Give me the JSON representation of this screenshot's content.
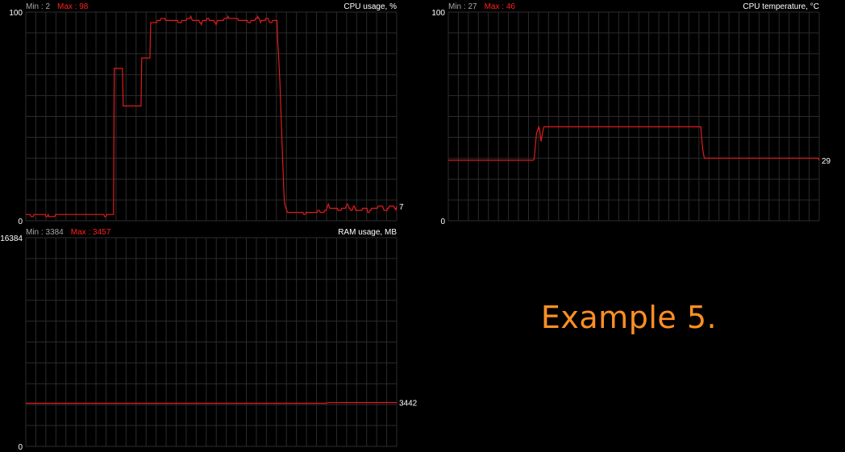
{
  "colors": {
    "background": "#000000",
    "grid": "#2b2b2b",
    "series": "#e31b1b",
    "min_label": "#a7a7a7",
    "max_label": "#ff2020",
    "title": "#ffffff",
    "axis_label": "#ffffff",
    "caption": "#ff8f23"
  },
  "caption": "Example 5.",
  "chart_data": [
    {
      "type": "line",
      "title": "CPU usage, %",
      "min_text": "Min : 2",
      "max_text": "Max : 98",
      "ylim": [
        0,
        100
      ],
      "ytick_top": "100",
      "ytick_bottom": "0",
      "current": "7",
      "values": [
        3,
        3,
        3,
        3,
        3,
        3,
        3,
        2,
        2,
        2,
        2,
        3,
        3,
        3,
        3,
        3,
        3,
        3,
        3,
        3,
        3,
        3,
        3,
        3,
        3,
        3,
        3,
        2,
        2,
        2,
        3,
        2,
        2,
        2,
        2,
        2,
        2,
        2,
        2,
        2,
        3,
        3,
        3,
        3,
        3,
        3,
        3,
        3,
        3,
        3,
        3,
        3,
        3,
        3,
        3,
        3,
        3,
        3,
        3,
        3,
        3,
        3,
        3,
        3,
        3,
        3,
        3,
        3,
        3,
        3,
        3,
        3,
        3,
        3,
        3,
        3,
        3,
        3,
        3,
        3,
        3,
        3,
        3,
        3,
        3,
        3,
        3,
        3,
        3,
        3,
        3,
        3,
        3,
        3,
        3,
        3,
        3,
        3,
        3,
        3,
        3,
        3,
        3,
        3,
        3,
        3,
        2,
        2,
        2,
        3,
        3,
        3,
        3,
        3,
        3,
        3,
        3,
        3,
        3,
        73,
        73,
        73,
        73,
        73,
        73,
        73,
        73,
        73,
        73,
        73,
        73,
        55,
        55,
        55,
        55,
        55,
        55,
        55,
        55,
        55,
        55,
        55,
        55,
        55,
        55,
        55,
        55,
        55,
        55,
        55,
        55,
        55,
        55,
        55,
        55,
        55,
        78,
        78,
        78,
        78,
        78,
        78,
        78,
        78,
        78,
        78,
        78,
        78,
        95,
        95,
        95,
        95,
        95,
        95,
        95,
        95,
        95,
        96,
        96,
        96,
        96,
        96,
        97,
        97,
        97,
        97,
        97,
        97,
        96,
        96,
        96,
        96,
        96,
        96,
        96,
        96,
        96,
        96,
        96,
        96,
        96,
        96,
        96,
        96,
        96,
        95,
        95,
        95,
        95,
        95,
        96,
        96,
        96,
        96,
        96,
        96,
        96,
        97,
        97,
        97,
        97,
        97,
        98,
        97,
        96,
        96,
        96,
        96,
        96,
        96,
        96,
        96,
        96,
        96,
        95,
        95,
        94,
        95,
        96,
        96,
        96,
        96,
        96,
        96,
        97,
        97,
        97,
        96,
        96,
        96,
        96,
        96,
        96,
        96,
        95,
        95,
        94,
        95,
        96,
        96,
        96,
        96,
        96,
        96,
        96,
        96,
        96,
        97,
        97,
        97,
        97,
        97,
        98,
        97,
        97,
        97,
        97,
        97,
        97,
        97,
        97,
        97,
        97,
        97,
        97,
        97,
        96,
        96,
        96,
        96,
        96,
        96,
        96,
        96,
        96,
        96,
        96,
        96,
        96,
        95,
        95,
        95,
        95,
        96,
        96,
        96,
        96,
        96,
        96,
        97,
        97,
        97,
        98,
        97,
        97,
        96,
        95,
        96,
        96,
        96,
        96,
        96,
        96,
        97,
        97,
        97,
        97,
        96,
        95,
        95,
        95,
        95,
        96,
        96,
        96,
        96,
        96,
        96,
        96,
        85,
        80,
        73,
        65,
        55,
        45,
        35,
        25,
        15,
        9,
        7,
        6,
        5,
        4,
        4,
        4,
        4,
        4,
        4,
        4,
        4,
        4,
        4,
        4,
        4,
        4,
        4,
        4,
        4,
        4,
        4,
        4,
        4,
        4,
        4,
        3,
        3,
        3,
        4,
        4,
        4,
        4,
        4,
        4,
        4,
        4,
        4,
        4,
        4,
        4,
        4,
        4,
        4,
        4,
        5,
        5,
        5,
        4,
        4,
        4,
        4,
        4,
        4,
        5,
        5,
        5,
        6,
        7,
        8,
        7,
        6,
        6,
        6,
        6,
        6,
        6,
        6,
        6,
        6,
        6,
        6,
        5,
        5,
        5,
        5,
        5,
        6,
        6,
        6,
        6,
        6,
        6,
        7,
        8,
        8,
        7,
        6,
        6,
        5,
        5,
        5,
        6,
        7,
        7,
        6,
        5,
        5,
        5,
        5,
        5,
        5,
        5,
        5,
        5,
        6,
        6,
        6,
        6,
        6,
        6,
        6,
        4,
        4,
        4,
        5,
        5,
        6,
        6,
        6,
        6,
        6,
        6,
        6,
        6,
        6,
        7,
        7,
        7,
        7,
        7,
        7,
        7,
        6,
        5,
        5,
        5,
        5,
        5,
        6,
        6,
        7,
        7,
        7,
        7,
        7,
        7,
        7,
        6,
        6,
        5,
        7
      ]
    },
    {
      "type": "line",
      "title": "CPU temperature, °C",
      "min_text": "Min : 27",
      "max_text": "Max : 46",
      "ylim": [
        0,
        100
      ],
      "ytick_top": "100",
      "ytick_bottom": "0",
      "current": "29",
      "values": [
        29,
        29,
        29,
        29,
        29,
        29,
        29,
        29,
        29,
        29,
        29,
        29,
        29,
        29,
        29,
        29,
        29,
        29,
        29,
        29,
        29,
        29,
        29,
        29,
        29,
        29,
        29,
        29,
        29,
        29,
        29,
        29,
        29,
        29,
        29,
        29,
        29,
        29,
        29,
        29,
        29,
        29,
        29,
        29,
        29,
        29,
        29,
        29,
        29,
        29,
        29,
        29,
        29,
        29,
        29,
        29,
        29,
        29,
        29,
        29,
        29,
        29,
        29,
        29,
        29,
        29,
        29,
        29,
        29,
        29,
        29,
        29,
        29,
        29,
        29,
        29,
        29,
        29,
        29,
        29,
        29,
        29,
        29,
        29,
        29,
        29,
        29,
        29,
        29,
        29,
        29,
        29,
        29,
        29,
        29,
        29,
        29,
        29,
        29,
        29,
        29,
        29,
        29,
        29,
        29,
        29,
        29,
        29,
        29,
        29,
        29,
        29,
        29,
        29,
        30,
        34,
        38,
        42,
        43,
        44,
        45,
        44,
        41,
        38,
        40,
        42,
        44,
        45,
        45,
        45,
        45,
        45,
        45,
        45,
        45,
        45,
        45,
        45,
        45,
        45,
        45,
        45,
        45,
        45,
        45,
        45,
        45,
        45,
        45,
        45,
        45,
        45,
        45,
        45,
        45,
        45,
        45,
        45,
        45,
        45,
        45,
        45,
        45,
        45,
        45,
        45,
        45,
        45,
        45,
        45,
        45,
        45,
        45,
        45,
        45,
        45,
        45,
        45,
        45,
        45,
        45,
        45,
        45,
        45,
        45,
        45,
        45,
        45,
        45,
        45,
        45,
        45,
        45,
        45,
        45,
        45,
        45,
        45,
        45,
        45,
        45,
        45,
        45,
        45,
        45,
        45,
        45,
        45,
        45,
        45,
        45,
        45,
        45,
        45,
        45,
        45,
        45,
        45,
        45,
        45,
        45,
        45,
        45,
        45,
        45,
        45,
        45,
        45,
        45,
        45,
        45,
        45,
        45,
        45,
        45,
        45,
        45,
        45,
        45,
        45,
        45,
        45,
        45,
        45,
        45,
        45,
        45,
        45,
        45,
        45,
        45,
        45,
        45,
        45,
        45,
        45,
        45,
        45,
        45,
        45,
        45,
        45,
        45,
        45,
        45,
        45,
        45,
        45,
        45,
        45,
        45,
        45,
        45,
        45,
        45,
        45,
        45,
        45,
        45,
        45,
        45,
        45,
        45,
        45,
        45,
        45,
        45,
        45,
        45,
        45,
        45,
        45,
        45,
        45,
        45,
        45,
        45,
        45,
        45,
        45,
        45,
        45,
        45,
        45,
        45,
        45,
        45,
        45,
        45,
        45,
        45,
        45,
        45,
        45,
        45,
        45,
        45,
        45,
        45,
        45,
        45,
        45,
        45,
        45,
        45,
        45,
        45,
        45,
        45,
        45,
        45,
        45,
        45,
        45,
        45,
        45,
        40,
        36,
        33,
        31,
        30,
        30,
        30,
        30,
        30,
        30,
        30,
        30,
        30,
        30,
        30,
        30,
        30,
        30,
        30,
        30,
        30,
        30,
        30,
        30,
        30,
        30,
        30,
        30,
        30,
        30,
        30,
        30,
        30,
        30,
        30,
        30,
        30,
        30,
        30,
        30,
        30,
        30,
        30,
        30,
        30,
        30,
        30,
        30,
        30,
        30,
        30,
        30,
        30,
        30,
        30,
        30,
        30,
        30,
        30,
        30,
        30,
        30,
        30,
        30,
        30,
        30,
        30,
        30,
        30,
        30,
        30,
        30,
        30,
        30,
        30,
        30,
        30,
        30,
        30,
        30,
        30,
        30,
        30,
        30,
        30,
        30,
        30,
        30,
        30,
        30,
        30,
        30,
        30,
        30,
        30,
        30,
        30,
        30,
        30,
        30,
        30,
        30,
        30,
        30,
        30,
        30,
        30,
        30,
        30,
        30,
        30,
        30,
        30,
        30,
        30,
        30,
        30,
        30,
        30,
        30,
        30,
        30,
        30,
        30,
        30,
        30,
        30,
        30,
        30,
        30,
        30,
        30,
        30,
        30,
        30,
        30,
        30,
        30,
        30,
        30,
        30,
        30,
        30,
        30,
        30,
        30,
        30,
        30,
        30,
        30,
        30,
        30,
        30,
        30,
        30,
        30,
        29
      ]
    },
    {
      "type": "line",
      "title": "RAM usage, MB",
      "min_text": "Min : 3384",
      "max_text": "Max : 3457",
      "ylim": [
        0,
        16384
      ],
      "ytick_top": "16384",
      "ytick_bottom": "0",
      "current": "3442",
      "values": [
        3384,
        3384,
        3384,
        3384,
        3384,
        3384,
        3384,
        3384,
        3384,
        3384,
        3384,
        3384,
        3384,
        3384,
        3384,
        3384,
        3384,
        3384,
        3384,
        3384,
        3384,
        3384,
        3384,
        3384,
        3384,
        3384,
        3384,
        3384,
        3384,
        3384,
        3384,
        3384,
        3384,
        3384,
        3384,
        3384,
        3384,
        3384,
        3384,
        3384,
        3384,
        3384,
        3384,
        3384,
        3384,
        3384,
        3384,
        3384,
        3384,
        3384,
        3384,
        3384,
        3384,
        3384,
        3384,
        3384,
        3384,
        3384,
        3384,
        3384,
        3384,
        3384,
        3384,
        3384,
        3384,
        3384,
        3384,
        3384,
        3384,
        3384,
        3384,
        3384,
        3384,
        3384,
        3384,
        3384,
        3384,
        3384,
        3384,
        3384,
        3384,
        3384,
        3384,
        3384,
        3384,
        3384,
        3384,
        3384,
        3384,
        3384,
        3384,
        3384,
        3384,
        3384,
        3384,
        3384,
        3384,
        3384,
        3384,
        3384,
        3384,
        3384,
        3384,
        3384,
        3384,
        3384,
        3384,
        3384,
        3384,
        3384,
        3384,
        3384,
        3384,
        3384,
        3384,
        3384,
        3384,
        3384,
        3384,
        3384,
        3384,
        3384,
        3384,
        3384,
        3384,
        3384,
        3384,
        3384,
        3384,
        3384,
        3384,
        3384,
        3384,
        3384,
        3384,
        3384,
        3384,
        3384,
        3384,
        3384,
        3384,
        3384,
        3384,
        3384,
        3384,
        3384,
        3384,
        3384,
        3384,
        3384,
        3384,
        3384,
        3384,
        3384,
        3384,
        3384,
        3384,
        3384,
        3384,
        3384,
        3384,
        3384,
        3384,
        3384,
        3384,
        3384,
        3384,
        3384,
        3384,
        3384,
        3384,
        3384,
        3384,
        3384,
        3384,
        3384,
        3384,
        3384,
        3384,
        3384,
        3384,
        3384,
        3384,
        3384,
        3384,
        3384,
        3384,
        3384,
        3384,
        3384,
        3384,
        3384,
        3384,
        3384,
        3384,
        3384,
        3384,
        3384,
        3384,
        3384,
        3384,
        3384,
        3384,
        3384,
        3384,
        3384,
        3384,
        3384,
        3384,
        3384,
        3384,
        3384,
        3384,
        3384,
        3384,
        3384,
        3384,
        3384,
        3384,
        3384,
        3384,
        3384,
        3384,
        3384,
        3384,
        3384,
        3384,
        3384,
        3384,
        3384,
        3384,
        3384,
        3384,
        3384,
        3384,
        3384,
        3384,
        3384,
        3384,
        3384,
        3384,
        3384,
        3384,
        3384,
        3384,
        3384,
        3384,
        3384,
        3384,
        3384,
        3384,
        3384,
        3384,
        3384,
        3384,
        3384,
        3384,
        3384,
        3384,
        3384,
        3384,
        3384,
        3384,
        3384,
        3384,
        3384,
        3384,
        3384,
        3384,
        3384,
        3384,
        3384,
        3384,
        3384,
        3384,
        3384,
        3384,
        3384,
        3384,
        3384,
        3384,
        3384,
        3384,
        3384,
        3384,
        3384,
        3384,
        3384,
        3384,
        3384,
        3384,
        3384,
        3384,
        3384,
        3384,
        3384,
        3384,
        3384,
        3384,
        3384,
        3384,
        3384,
        3384,
        3384,
        3384,
        3384,
        3384,
        3384,
        3384,
        3384,
        3384,
        3384,
        3384,
        3384,
        3384,
        3384,
        3384,
        3384,
        3384,
        3384,
        3384,
        3384,
        3384,
        3384,
        3384,
        3384,
        3384,
        3384,
        3384,
        3384,
        3384,
        3384,
        3384,
        3384,
        3384,
        3384,
        3384,
        3384,
        3384,
        3384,
        3384,
        3384,
        3384,
        3384,
        3384,
        3384,
        3384,
        3384,
        3384,
        3384,
        3384,
        3384,
        3384,
        3384,
        3384,
        3384,
        3384,
        3384,
        3384,
        3384,
        3384,
        3384,
        3384,
        3384,
        3384,
        3384,
        3384,
        3384,
        3384,
        3384,
        3384,
        3384,
        3384,
        3384,
        3384,
        3384,
        3384,
        3384,
        3384,
        3384,
        3384,
        3384,
        3384,
        3384,
        3384,
        3384,
        3384,
        3384,
        3384,
        3384,
        3420,
        3428,
        3430,
        3432,
        3432,
        3434,
        3434,
        3434,
        3435,
        3435,
        3436,
        3436,
        3436,
        3437,
        3437,
        3438,
        3438,
        3438,
        3439,
        3439,
        3439,
        3440,
        3440,
        3440,
        3441,
        3441,
        3441,
        3441,
        3441,
        3442,
        3442,
        3442,
        3442,
        3442,
        3442,
        3442,
        3442,
        3442,
        3442,
        3442,
        3442,
        3442,
        3442,
        3442,
        3442,
        3442,
        3442,
        3442,
        3442,
        3442,
        3442,
        3442,
        3442,
        3442,
        3442,
        3442,
        3442,
        3442,
        3442,
        3442,
        3442,
        3442,
        3442,
        3442,
        3442,
        3442,
        3442,
        3442,
        3442,
        3442,
        3442,
        3442,
        3442,
        3442,
        3442,
        3442,
        3442,
        3442,
        3442,
        3442,
        3442,
        3442,
        3442,
        3442,
        3442,
        3442,
        3442,
        3442,
        3442,
        3442,
        3442
      ]
    }
  ]
}
